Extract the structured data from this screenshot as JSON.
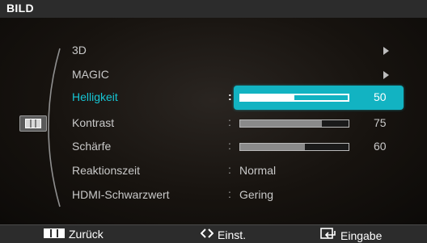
{
  "header": {
    "title": "BILD"
  },
  "menu": {
    "items": [
      {
        "label": "3D",
        "type": "submenu"
      },
      {
        "label": "MAGIC",
        "type": "submenu"
      },
      {
        "label": "Helligkeit",
        "type": "slider",
        "value": "50",
        "fraction": 0.5,
        "selected": true
      },
      {
        "label": "Kontrast",
        "type": "slider",
        "value": "75",
        "fraction": 0.75
      },
      {
        "label": "Schärfe",
        "type": "slider",
        "value": "60",
        "fraction": 0.6
      },
      {
        "label": "Reaktionszeit",
        "type": "option",
        "value": "Normal"
      },
      {
        "label": "HDMI-Schwarzwert",
        "type": "option",
        "value": "Gering"
      }
    ],
    "colon": ":"
  },
  "category_icon": "picture-menu-icon",
  "footer": {
    "back_label": "Zurück",
    "back_icon": "menu-bars-icon",
    "adjust_label": "Einst.",
    "adjust_icon": "diamond-arrows-icon",
    "enter_label": "Eingabe",
    "enter_icon": "enter-return-icon"
  },
  "colors": {
    "accent": "#12b3c2",
    "selected_label": "#16c5d4",
    "text": "#c9c9c9",
    "bar_fill": "#8a8a8a",
    "background": "#0d0b0a",
    "header": "#2c2c2c"
  }
}
